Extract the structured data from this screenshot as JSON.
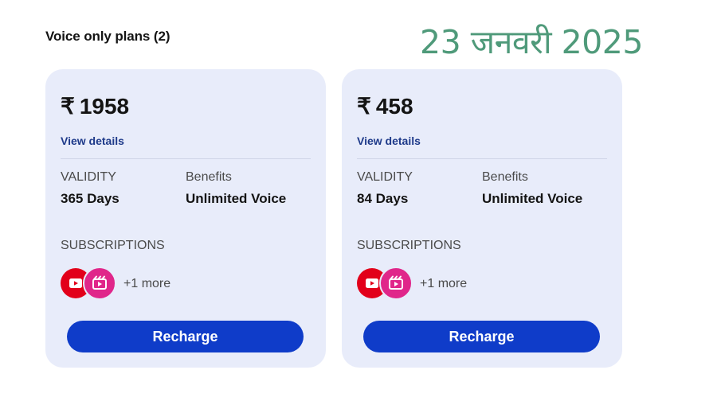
{
  "section": {
    "title": "Voice only plans (2)"
  },
  "overlay": {
    "date_text": "23 जनवरी 2025"
  },
  "colors": {
    "card_bg": "#e8ecfa",
    "button_bg": "#0f3cc9",
    "link": "#1e3a8a",
    "date_text": "#4f9a7a"
  },
  "plans": [
    {
      "currency": "₹",
      "price": "1958",
      "view_details": "View details",
      "validity_label": "VALIDITY",
      "validity_value": "365 Days",
      "benefits_label": "Benefits",
      "benefits_value": "Unlimited Voice",
      "subscriptions_label": "SUBSCRIPTIONS",
      "subscription_icons": [
        "jio-cinema-icon",
        "jio-shorts-icon"
      ],
      "more_label": "+1 more",
      "button_label": "Recharge"
    },
    {
      "currency": "₹",
      "price": "458",
      "view_details": "View details",
      "validity_label": "VALIDITY",
      "validity_value": "84 Days",
      "benefits_label": "Benefits",
      "benefits_value": "Unlimited Voice",
      "subscriptions_label": "SUBSCRIPTIONS",
      "subscription_icons": [
        "jio-cinema-icon",
        "jio-shorts-icon"
      ],
      "more_label": "+1 more",
      "button_label": "Recharge"
    }
  ]
}
